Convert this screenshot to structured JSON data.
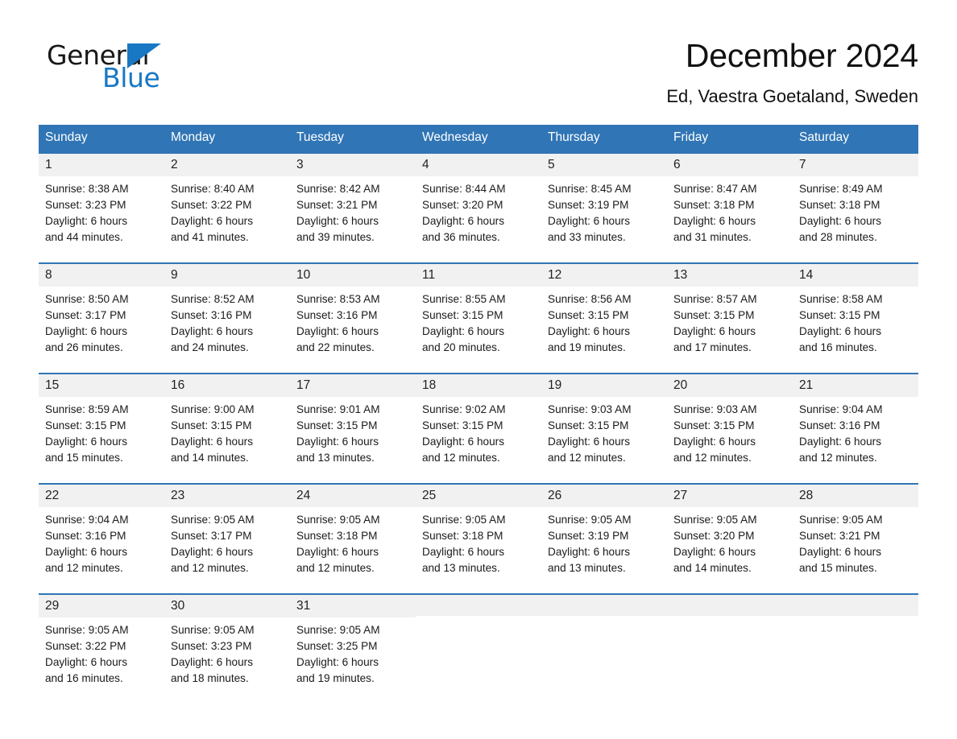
{
  "logo": {
    "word_one": "General",
    "word_two": "Blue",
    "triangle_icon": "triangle-icon",
    "accent_color": "#1878c4"
  },
  "header": {
    "title": "December 2024",
    "subtitle": "Ed, Vaestra Goetaland, Sweden"
  },
  "theme": {
    "header_blue": "#3075b5",
    "daynum_band": "#f1f1f1",
    "text": "#1a1a1a"
  },
  "calendar": {
    "weekday_headers": [
      "Sunday",
      "Monday",
      "Tuesday",
      "Wednesday",
      "Thursday",
      "Friday",
      "Saturday"
    ],
    "weeks": [
      [
        {
          "day": "1",
          "sunrise": "Sunrise: 8:38 AM",
          "sunset": "Sunset: 3:23 PM",
          "daylight_line1": "Daylight: 6 hours",
          "daylight_line2": "and 44 minutes."
        },
        {
          "day": "2",
          "sunrise": "Sunrise: 8:40 AM",
          "sunset": "Sunset: 3:22 PM",
          "daylight_line1": "Daylight: 6 hours",
          "daylight_line2": "and 41 minutes."
        },
        {
          "day": "3",
          "sunrise": "Sunrise: 8:42 AM",
          "sunset": "Sunset: 3:21 PM",
          "daylight_line1": "Daylight: 6 hours",
          "daylight_line2": "and 39 minutes."
        },
        {
          "day": "4",
          "sunrise": "Sunrise: 8:44 AM",
          "sunset": "Sunset: 3:20 PM",
          "daylight_line1": "Daylight: 6 hours",
          "daylight_line2": "and 36 minutes."
        },
        {
          "day": "5",
          "sunrise": "Sunrise: 8:45 AM",
          "sunset": "Sunset: 3:19 PM",
          "daylight_line1": "Daylight: 6 hours",
          "daylight_line2": "and 33 minutes."
        },
        {
          "day": "6",
          "sunrise": "Sunrise: 8:47 AM",
          "sunset": "Sunset: 3:18 PM",
          "daylight_line1": "Daylight: 6 hours",
          "daylight_line2": "and 31 minutes."
        },
        {
          "day": "7",
          "sunrise": "Sunrise: 8:49 AM",
          "sunset": "Sunset: 3:18 PM",
          "daylight_line1": "Daylight: 6 hours",
          "daylight_line2": "and 28 minutes."
        }
      ],
      [
        {
          "day": "8",
          "sunrise": "Sunrise: 8:50 AM",
          "sunset": "Sunset: 3:17 PM",
          "daylight_line1": "Daylight: 6 hours",
          "daylight_line2": "and 26 minutes."
        },
        {
          "day": "9",
          "sunrise": "Sunrise: 8:52 AM",
          "sunset": "Sunset: 3:16 PM",
          "daylight_line1": "Daylight: 6 hours",
          "daylight_line2": "and 24 minutes."
        },
        {
          "day": "10",
          "sunrise": "Sunrise: 8:53 AM",
          "sunset": "Sunset: 3:16 PM",
          "daylight_line1": "Daylight: 6 hours",
          "daylight_line2": "and 22 minutes."
        },
        {
          "day": "11",
          "sunrise": "Sunrise: 8:55 AM",
          "sunset": "Sunset: 3:15 PM",
          "daylight_line1": "Daylight: 6 hours",
          "daylight_line2": "and 20 minutes."
        },
        {
          "day": "12",
          "sunrise": "Sunrise: 8:56 AM",
          "sunset": "Sunset: 3:15 PM",
          "daylight_line1": "Daylight: 6 hours",
          "daylight_line2": "and 19 minutes."
        },
        {
          "day": "13",
          "sunrise": "Sunrise: 8:57 AM",
          "sunset": "Sunset: 3:15 PM",
          "daylight_line1": "Daylight: 6 hours",
          "daylight_line2": "and 17 minutes."
        },
        {
          "day": "14",
          "sunrise": "Sunrise: 8:58 AM",
          "sunset": "Sunset: 3:15 PM",
          "daylight_line1": "Daylight: 6 hours",
          "daylight_line2": "and 16 minutes."
        }
      ],
      [
        {
          "day": "15",
          "sunrise": "Sunrise: 8:59 AM",
          "sunset": "Sunset: 3:15 PM",
          "daylight_line1": "Daylight: 6 hours",
          "daylight_line2": "and 15 minutes."
        },
        {
          "day": "16",
          "sunrise": "Sunrise: 9:00 AM",
          "sunset": "Sunset: 3:15 PM",
          "daylight_line1": "Daylight: 6 hours",
          "daylight_line2": "and 14 minutes."
        },
        {
          "day": "17",
          "sunrise": "Sunrise: 9:01 AM",
          "sunset": "Sunset: 3:15 PM",
          "daylight_line1": "Daylight: 6 hours",
          "daylight_line2": "and 13 minutes."
        },
        {
          "day": "18",
          "sunrise": "Sunrise: 9:02 AM",
          "sunset": "Sunset: 3:15 PM",
          "daylight_line1": "Daylight: 6 hours",
          "daylight_line2": "and 12 minutes."
        },
        {
          "day": "19",
          "sunrise": "Sunrise: 9:03 AM",
          "sunset": "Sunset: 3:15 PM",
          "daylight_line1": "Daylight: 6 hours",
          "daylight_line2": "and 12 minutes."
        },
        {
          "day": "20",
          "sunrise": "Sunrise: 9:03 AM",
          "sunset": "Sunset: 3:15 PM",
          "daylight_line1": "Daylight: 6 hours",
          "daylight_line2": "and 12 minutes."
        },
        {
          "day": "21",
          "sunrise": "Sunrise: 9:04 AM",
          "sunset": "Sunset: 3:16 PM",
          "daylight_line1": "Daylight: 6 hours",
          "daylight_line2": "and 12 minutes."
        }
      ],
      [
        {
          "day": "22",
          "sunrise": "Sunrise: 9:04 AM",
          "sunset": "Sunset: 3:16 PM",
          "daylight_line1": "Daylight: 6 hours",
          "daylight_line2": "and 12 minutes."
        },
        {
          "day": "23",
          "sunrise": "Sunrise: 9:05 AM",
          "sunset": "Sunset: 3:17 PM",
          "daylight_line1": "Daylight: 6 hours",
          "daylight_line2": "and 12 minutes."
        },
        {
          "day": "24",
          "sunrise": "Sunrise: 9:05 AM",
          "sunset": "Sunset: 3:18 PM",
          "daylight_line1": "Daylight: 6 hours",
          "daylight_line2": "and 12 minutes."
        },
        {
          "day": "25",
          "sunrise": "Sunrise: 9:05 AM",
          "sunset": "Sunset: 3:18 PM",
          "daylight_line1": "Daylight: 6 hours",
          "daylight_line2": "and 13 minutes."
        },
        {
          "day": "26",
          "sunrise": "Sunrise: 9:05 AM",
          "sunset": "Sunset: 3:19 PM",
          "daylight_line1": "Daylight: 6 hours",
          "daylight_line2": "and 13 minutes."
        },
        {
          "day": "27",
          "sunrise": "Sunrise: 9:05 AM",
          "sunset": "Sunset: 3:20 PM",
          "daylight_line1": "Daylight: 6 hours",
          "daylight_line2": "and 14 minutes."
        },
        {
          "day": "28",
          "sunrise": "Sunrise: 9:05 AM",
          "sunset": "Sunset: 3:21 PM",
          "daylight_line1": "Daylight: 6 hours",
          "daylight_line2": "and 15 minutes."
        }
      ],
      [
        {
          "day": "29",
          "sunrise": "Sunrise: 9:05 AM",
          "sunset": "Sunset: 3:22 PM",
          "daylight_line1": "Daylight: 6 hours",
          "daylight_line2": "and 16 minutes."
        },
        {
          "day": "30",
          "sunrise": "Sunrise: 9:05 AM",
          "sunset": "Sunset: 3:23 PM",
          "daylight_line1": "Daylight: 6 hours",
          "daylight_line2": "and 18 minutes."
        },
        {
          "day": "31",
          "sunrise": "Sunrise: 9:05 AM",
          "sunset": "Sunset: 3:25 PM",
          "daylight_line1": "Daylight: 6 hours",
          "daylight_line2": "and 19 minutes."
        },
        {
          "day": "",
          "sunrise": "",
          "sunset": "",
          "daylight_line1": "",
          "daylight_line2": ""
        },
        {
          "day": "",
          "sunrise": "",
          "sunset": "",
          "daylight_line1": "",
          "daylight_line2": ""
        },
        {
          "day": "",
          "sunrise": "",
          "sunset": "",
          "daylight_line1": "",
          "daylight_line2": ""
        },
        {
          "day": "",
          "sunrise": "",
          "sunset": "",
          "daylight_line1": "",
          "daylight_line2": ""
        }
      ]
    ]
  }
}
